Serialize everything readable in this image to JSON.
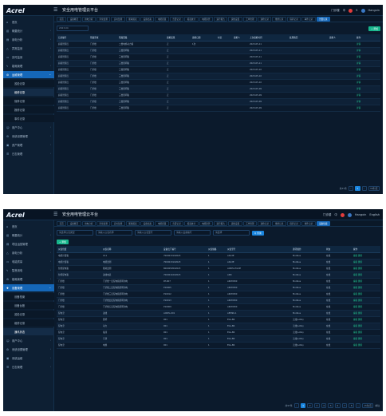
{
  "app": {
    "logo": "Acrel",
    "title": "安全用电管理云平台",
    "topbar_right": [
      "门诊楼",
      "中",
      "5",
      "Hangxin",
      "English"
    ]
  },
  "panel1": {
    "sidebar": [
      {
        "label": "首页",
        "icon": "home-icon"
      },
      {
        "label": "概要统计",
        "icon": "chart-icon"
      },
      {
        "label": "用电分析",
        "icon": "bar-icon"
      },
      {
        "label": "异常监测",
        "icon": "alert-icon"
      },
      {
        "label": "实时监测",
        "icon": "monitor-icon"
      },
      {
        "label": "能耗管理",
        "icon": "energy-icon"
      },
      {
        "label": "运维管理",
        "icon": "gear-icon"
      },
      {
        "label": "设备运维",
        "icon": "tool-icon"
      },
      {
        "label": "巡检记录",
        "icon": ""
      },
      {
        "label": "维修记录",
        "icon": ""
      },
      {
        "label": "保养记录",
        "icon": ""
      },
      {
        "label": "报修记录",
        "icon": ""
      },
      {
        "label": "事件记录",
        "icon": ""
      },
      {
        "label": "用户中心",
        "icon": "user-icon"
      },
      {
        "label": "系统设置管理",
        "icon": "settings-icon"
      },
      {
        "label": "资产管理",
        "icon": "asset-icon"
      },
      {
        "label": "日志管理",
        "icon": "log-icon"
      }
    ],
    "tabs": [
      "首页",
      "设备概况",
      "用电分析",
      "异常监测",
      "实时监测",
      "能耗报表",
      "设备档案",
      "电能质量",
      "告警记录",
      "报表统计",
      "电能趋势",
      "运行报告",
      "运维设置",
      "工单管理",
      "巡检记录",
      "维修记录",
      "保养记录",
      "事件记录",
      "告警记录"
    ],
    "date_field": "2023-04",
    "add_button": "+ 添加",
    "headers": [
      "记录编号",
      "所属区域",
      "所属回路",
      "巡检结果",
      "巡检日期",
      "时长",
      "巡检人",
      "上次巡检时间",
      "处理情况",
      "巡检人",
      "操作"
    ],
    "rows": [
      [
        "超级管理员",
        "门诊楼",
        "二楼电梯动力箱",
        "正",
        "1次",
        "",
        "",
        "2023-05-11",
        "",
        "",
        "详情"
      ],
      [
        "超级管理员",
        "门诊楼",
        "三楼照明箱",
        "正",
        "",
        "",
        "",
        "2023-05-11",
        "",
        "",
        "详情"
      ],
      [
        "超级管理员",
        "门诊楼",
        "三楼照明箱",
        "正",
        "",
        "",
        "",
        "2023-05-11",
        "",
        "",
        "详情"
      ],
      [
        "超级管理员",
        "门诊楼",
        "三楼照明箱",
        "正",
        "",
        "",
        "",
        "2023-05-11",
        "",
        "",
        "详情"
      ],
      [
        "超级管理员",
        "门诊楼",
        "三楼照明箱",
        "正",
        "",
        "",
        "",
        "2023-05-10",
        "",
        "",
        "详情"
      ],
      [
        "超级管理员",
        "门诊楼",
        "三楼照明箱",
        "正",
        "",
        "",
        "",
        "2023-05-10",
        "",
        "",
        "详情"
      ],
      [
        "超级管理员",
        "门诊楼",
        "三楼照明箱",
        "正",
        "",
        "",
        "",
        "2023-05-10",
        "",
        "",
        "详情"
      ],
      [
        "超级管理员",
        "门诊楼",
        "三楼照明箱",
        "正",
        "",
        "",
        "",
        "2023-05-09",
        "",
        "",
        "详情"
      ],
      [
        "超级管理员",
        "门诊楼",
        "三楼照明箱",
        "正",
        "",
        "",
        "",
        "2023-05-09",
        "",
        "",
        "详情"
      ],
      [
        "超级管理员",
        "门诊楼",
        "三楼照明箱",
        "正",
        "",
        "",
        "",
        "2023-05-09",
        "",
        "",
        "详情"
      ],
      [
        "超级管理员",
        "门诊楼",
        "三楼照明箱",
        "正",
        "",
        "",
        "",
        "2023-05-09",
        "",
        "",
        "详情"
      ]
    ],
    "pager": {
      "total": "共11条",
      "page": "1",
      "page_size": "10条/页"
    }
  },
  "panel2": {
    "sidebar": [
      {
        "label": "首页",
        "icon": "home-icon"
      },
      {
        "label": "概要统计",
        "icon": "chart-icon"
      },
      {
        "label": "项目运营管理",
        "icon": "bar-icon"
      },
      {
        "label": "用电分析",
        "icon": "alert-icon"
      },
      {
        "label": "电能质量",
        "icon": "monitor-icon"
      },
      {
        "label": "智慧用电",
        "icon": "energy-icon"
      },
      {
        "label": "能耗管理",
        "icon": "gear-icon"
      },
      {
        "label": "设备管理",
        "icon": "tool-icon"
      },
      {
        "label": "设备档案",
        "icon": ""
      },
      {
        "label": "设备台账",
        "icon": ""
      },
      {
        "label": "巡检记录",
        "icon": ""
      },
      {
        "label": "维修记录",
        "icon": ""
      },
      {
        "label": "通讯状态",
        "icon": ""
      },
      {
        "label": "用户中心",
        "icon": "user-icon"
      },
      {
        "label": "系统设置管理",
        "icon": "settings-icon"
      },
      {
        "label": "系统运维",
        "icon": "asset-icon"
      },
      {
        "label": "日志管理",
        "icon": "log-icon"
      }
    ],
    "tabs": [
      "首页",
      "设备概况",
      "用电分析",
      "异常监测",
      "实时监测",
      "能耗报表",
      "设备档案",
      "电能质量",
      "告警记录",
      "报表统计",
      "电能趋势",
      "运行报告",
      "运维设置",
      "工单管理",
      "巡检记录",
      "维修记录",
      "保养记录",
      "事件记录",
      "设备档案"
    ],
    "filters": [
      "请选择仪表类型",
      "请输入仪表名称",
      "请输入仪表型号",
      "请输入设备编号",
      "请选择"
    ],
    "search_button": "Q 查询",
    "add_button": "+ 添加",
    "headers": [
      "仪表位置",
      "仪表名称",
      "设备出厂编号",
      "仪表规格",
      "仪表型号",
      "通讯规约",
      "状态",
      "操作"
    ],
    "rows": [
      [
        "电能计量箱",
        "C11",
        "7000013102023",
        "1",
        "ADL3E",
        "Modbus",
        "在线",
        "编辑 删除"
      ],
      [
        "电能计量箱",
        "电能监测",
        "7000013102023",
        "1",
        "ADL3E",
        "Modbus",
        "在线",
        "编辑 删除"
      ],
      [
        "智能配电箱",
        "能耗监测",
        "8000050502023",
        "1",
        "ACREL-E4-DP",
        "Modbus",
        "在线",
        "编辑 删除"
      ],
      [
        "智能配电箱",
        "进线电表",
        "7000011002023",
        "1",
        "AMC",
        "Modbus",
        "在线",
        "编辑 删除"
      ],
      [
        "门诊楼",
        "门诊楼一层配电箱照明用电",
        "RT-007",
        "1",
        "ARCM300",
        "Modbus",
        "在线",
        "编辑 删除"
      ],
      [
        "门诊楼",
        "门诊楼二层配电箱照明用电",
        "P10005",
        "1",
        "ARCM300",
        "Modbus",
        "在线",
        "编辑 删除"
      ],
      [
        "门诊楼",
        "门诊楼三层配电箱照明用电",
        "P10012",
        "1",
        "ARCM300",
        "Modbus",
        "在线",
        "编辑 删除"
      ],
      [
        "门诊楼",
        "门诊楼四层配电箱照明用电",
        "P10013",
        "1",
        "ARCM300",
        "Modbus",
        "在线",
        "编辑 删除"
      ],
      [
        "门诊楼",
        "门诊楼五层配电箱照明用电",
        "P10009",
        "1",
        "ARCM300",
        "Modbus",
        "在线",
        "编辑 删除"
      ],
      [
        "配电室",
        "进线",
        "ACREL-001",
        "1",
        "AEM96-1",
        "Modbus",
        "在线",
        "编辑 删除"
      ],
      [
        "配电室",
        "照明",
        "001",
        "1",
        "EGL-B6",
        "无线(LoRa)",
        "在线",
        "编辑 删除"
      ],
      [
        "配电室",
        "动力",
        "001",
        "1",
        "EGL-B6",
        "无线(LoRa)",
        "在线",
        "编辑 删除"
      ],
      [
        "配电室",
        "插座",
        "001",
        "1",
        "EGL-B6",
        "无线(LoRa)",
        "在线",
        "编辑 删除"
      ],
      [
        "配电室",
        "空调",
        "001",
        "1",
        "EGL-B6",
        "无线(LoRa)",
        "在线",
        "编辑 删除"
      ],
      [
        "配电室",
        "电梯",
        "001",
        "1",
        "EGL-B6",
        "无线(LoRa)",
        "在线",
        "编辑 删除"
      ]
    ],
    "pager": {
      "total": "共97条",
      "pages": [
        "1",
        "2",
        "3",
        "4",
        "5",
        "6",
        "7",
        "8"
      ],
      "page_size": "15条/页",
      "goto": "前往"
    }
  }
}
